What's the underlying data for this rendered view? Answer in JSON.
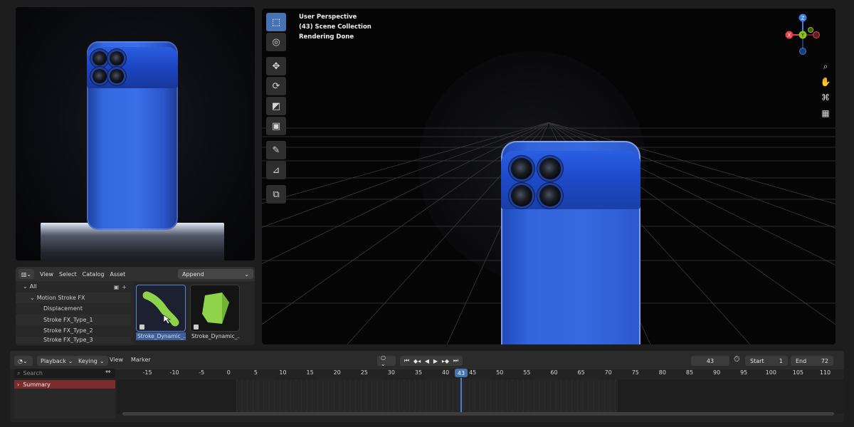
{
  "asset_browser": {
    "menu": [
      "View",
      "Select",
      "Catalog",
      "Asset"
    ],
    "import_mode": "Append",
    "tree": [
      {
        "label": "All",
        "indent": 0
      },
      {
        "label": "Motion Stroke FX",
        "indent": 1
      },
      {
        "label": "Displacement",
        "indent": 2
      },
      {
        "label": "Stroke FX_Type_1",
        "indent": 2
      },
      {
        "label": "Stroke FX_Type_2",
        "indent": 2
      },
      {
        "label": "Stroke FX_Type_3",
        "indent": 2
      }
    ],
    "assets": [
      {
        "label": "Stroke_Dynamic_...",
        "selected": true
      },
      {
        "label": "Stroke_Dynamic_...",
        "selected": false
      }
    ]
  },
  "viewport": {
    "info_lines": [
      "User Perspective",
      "(43) Scene Collection",
      "Rendering Done"
    ],
    "gizmo_axes": [
      "Z",
      "X",
      "Y"
    ],
    "colors": {
      "x": "#e8404a",
      "y": "#8ac21b",
      "z": "#3e7be6"
    }
  },
  "timeline": {
    "playback_label": "Playback",
    "keying_label": "Keying",
    "menu": [
      "View",
      "Marker"
    ],
    "current_frame": "43",
    "start_label": "Start",
    "start_value": "1",
    "end_label": "End",
    "end_value": "72",
    "search_placeholder": "Search",
    "summary_label": "Summary",
    "ruler_ticks": [
      "-15",
      "-10",
      "-5",
      "0",
      "5",
      "10",
      "15",
      "20",
      "25",
      "30",
      "35",
      "40",
      "45",
      "50",
      "55",
      "60",
      "65",
      "70",
      "75",
      "80",
      "85",
      "90",
      "95",
      "100",
      "105",
      "110"
    ],
    "playhead_label": "43"
  }
}
